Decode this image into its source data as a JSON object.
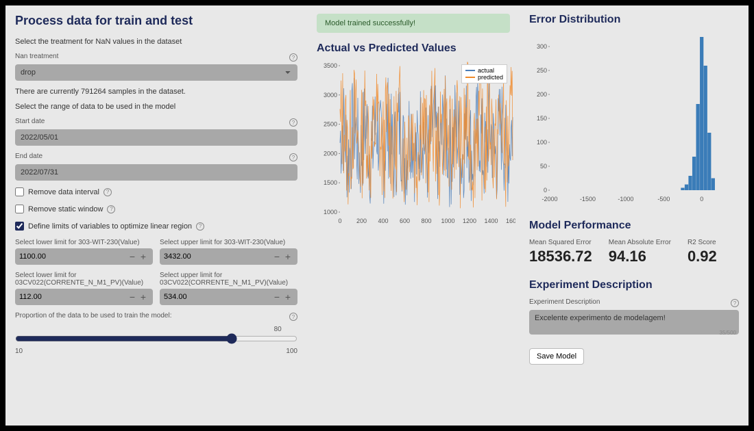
{
  "left": {
    "title": "Process data for train and test",
    "nan_prompt": "Select the treatment for NaN values in the dataset",
    "nan_label": "Nan treatment",
    "nan_value": "drop",
    "sample_info": "There are currently 791264 samples in the dataset.",
    "range_prompt": "Select the range of data to be used in the model",
    "start_label": "Start date",
    "start_value": "2022/05/01",
    "end_label": "End date",
    "end_value": "2022/07/31",
    "cb_remove_interval": "Remove data interval",
    "cb_remove_static": "Remove static window",
    "cb_define_limits": "Define limits of variables to optimize linear region",
    "ll1_label": "Select lower limit for 303-WIT-230(Value)",
    "ll1_value": "1100.00",
    "ul1_label": "Select upper limit for 303-WIT-230(Value)",
    "ul1_value": "3432.00",
    "ll2_label": "Select lower limit for 03CV022(CORRENTE_N_M1_PV)(Value)",
    "ll2_value": "112.00",
    "ul2_label": "Select upper limit for 03CV022(CORRENTE_N_M1_PV)(Value)",
    "ul2_value": "534.00",
    "proportion_label": "Proportion of the data to be used to train the model:",
    "proportion_value": "80",
    "prop_min": "10",
    "prop_max": "100"
  },
  "mid": {
    "success_msg": "Model trained successfully!",
    "chart_title": "Actual vs Predicted Values",
    "legend_actual": "actual",
    "legend_predicted": "predicted"
  },
  "right": {
    "err_title": "Error Distribution",
    "perf_title": "Model Performance",
    "mse_label": "Mean Squared Error",
    "mse_value": "18536.72",
    "mae_label": "Mean Absolute Error",
    "mae_value": "94.16",
    "r2_label": "R2 Score",
    "r2_value": "0.92",
    "exp_title": "Experiment Description",
    "exp_label": "Experiment Description",
    "exp_value": "Excelente experimento de modelagem!",
    "char_count": "35/500",
    "save_btn": "Save Model"
  },
  "chart_data": [
    {
      "type": "line",
      "title": "Actual vs Predicted Values",
      "x_range": [
        0,
        1600
      ],
      "y_range": [
        1000,
        3500
      ],
      "x_ticks": [
        0,
        200,
        400,
        600,
        800,
        1000,
        1200,
        1400,
        1600
      ],
      "y_ticks": [
        1000,
        1500,
        2000,
        2500,
        3000,
        3500
      ],
      "series": [
        {
          "name": "actual",
          "color": "#4a7db8",
          "note": "dense noisy signal oscillating roughly 1200-3300, mean ~2200"
        },
        {
          "name": "predicted",
          "color": "#f08a2a",
          "note": "dense noisy signal oscillating roughly 1300-3700, mean ~2300, overlaps actual"
        }
      ],
      "legend_position": "top-right"
    },
    {
      "type": "bar",
      "title": "Error Distribution",
      "x_range": [
        -2000,
        200
      ],
      "y_range": [
        0,
        320
      ],
      "x_ticks": [
        -2000,
        -1500,
        -1000,
        -500,
        0
      ],
      "y_ticks": [
        0,
        50,
        100,
        150,
        200,
        250,
        300
      ],
      "categories": [
        -250,
        -200,
        -150,
        -100,
        -50,
        0,
        50,
        100,
        150
      ],
      "values": [
        5,
        12,
        30,
        70,
        180,
        320,
        260,
        120,
        25
      ],
      "color": "#3a7cb8"
    }
  ]
}
